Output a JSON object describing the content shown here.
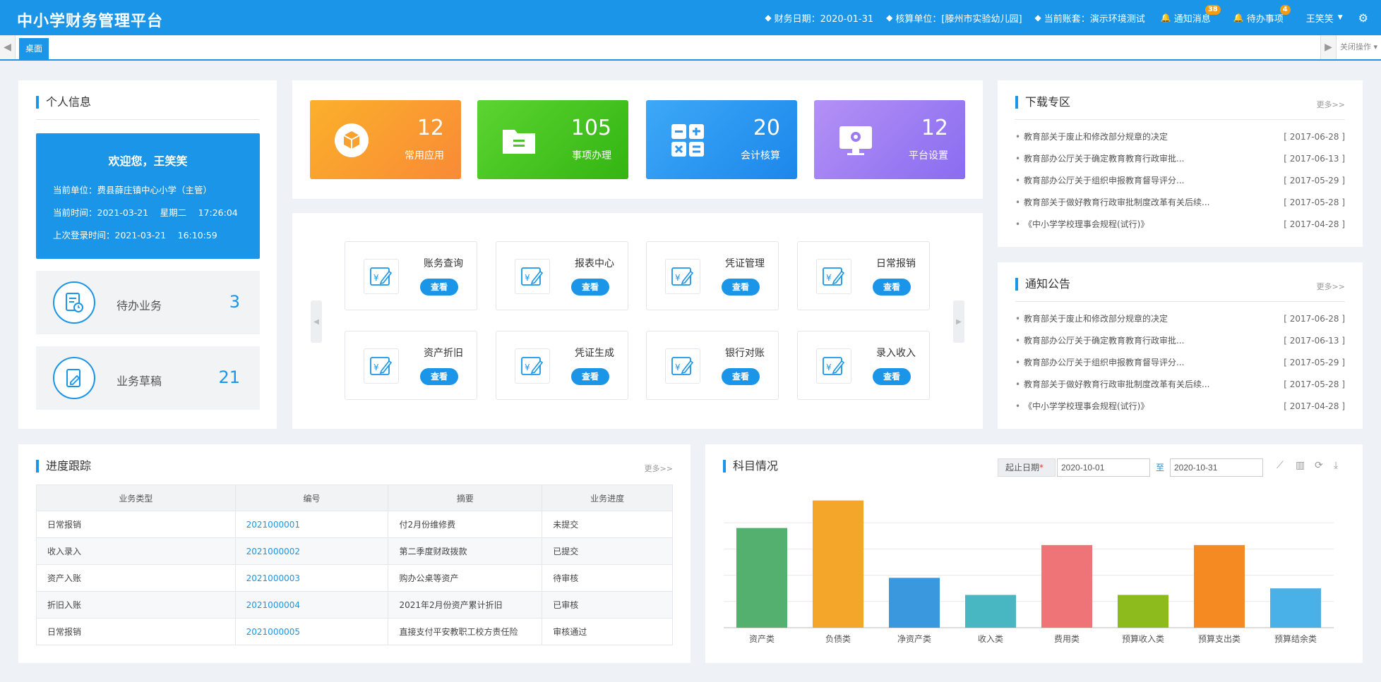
{
  "header": {
    "title": "中小学财务管理平台",
    "finance_date": "财务日期：2020-01-31",
    "unit": "核算单位：[滕州市实验幼儿园]",
    "account_set": "当前账套：演示环境测试",
    "notice": "通知消息",
    "notice_count": "38",
    "todo": "待办事项",
    "todo_count": "4",
    "user": "王笑笑"
  },
  "tabs": {
    "items": [
      "桌面"
    ],
    "close_label": "关闭操作"
  },
  "personal": {
    "title": "个人信息",
    "welcome": "欢迎您，王笑笑",
    "unit": "当前单位：费县薛庄镇中心小学（主管）",
    "time": "当前时间：2021-03-21　 星期二　 17:26:04",
    "last_login": "上次登录时间：2021-03-21　 16:10:59",
    "stats": [
      {
        "label": "待办业务",
        "value": "3"
      },
      {
        "label": "业务草稿",
        "value": "21"
      }
    ]
  },
  "tiles": [
    {
      "value": "12",
      "label": "常用应用",
      "icon": "cube-icon"
    },
    {
      "value": "105",
      "label": "事项办理",
      "icon": "folder-icon"
    },
    {
      "value": "20",
      "label": "会计核算",
      "icon": "calculator-icon"
    },
    {
      "value": "12",
      "label": "平台设置",
      "icon": "monitor-settings-icon"
    }
  ],
  "shortcuts": {
    "button_label": "查看",
    "items": [
      "账务查询",
      "报表中心",
      "凭证管理",
      "日常报销",
      "资产折旧",
      "凭证生成",
      "银行对账",
      "录入收入"
    ]
  },
  "downloads": {
    "title": "下载专区",
    "more": "更多>>",
    "items": [
      {
        "text": "教育部关于废止和修改部分规章的决定",
        "date": "[ 2017-06-28 ]"
      },
      {
        "text": "教育部办公厅关于确定教育教育行政审批...",
        "date": "[ 2017-06-13 ]"
      },
      {
        "text": "教育部办公厅关于组织申报教育督导评分...",
        "date": "[ 2017-05-29 ]"
      },
      {
        "text": "教育部关于做好教育行政审批制度改革有关后续...",
        "date": "[ 2017-05-28 ]"
      },
      {
        "text": "《中小学学校理事会规程(试行)》",
        "date": "[ 2017-04-28 ]"
      }
    ]
  },
  "notices": {
    "title": "通知公告",
    "more": "更多>>",
    "items": [
      {
        "text": "教育部关于废止和修改部分规章的决定",
        "date": "[ 2017-06-28 ]"
      },
      {
        "text": "教育部办公厅关于确定教育教育行政审批...",
        "date": "[ 2017-06-13 ]"
      },
      {
        "text": "教育部办公厅关于组织申报教育督导评分...",
        "date": "[ 2017-05-29 ]"
      },
      {
        "text": "教育部关于做好教育行政审批制度改革有关后续...",
        "date": "[ 2017-05-28 ]"
      },
      {
        "text": "《中小学学校理事会规程(试行)》",
        "date": "[ 2017-04-28 ]"
      }
    ]
  },
  "progress": {
    "title": "进度跟踪",
    "more": "更多>>",
    "columns": [
      "业务类型",
      "编号",
      "摘要",
      "业务进度"
    ],
    "rows": [
      [
        "日常报销",
        "2021000001",
        "付2月份维修费",
        "未提交"
      ],
      [
        "收入录入",
        "2021000002",
        "第二季度财政拨款",
        "已提交"
      ],
      [
        "资产入账",
        "2021000003",
        "购办公桌等资产",
        "待审核"
      ],
      [
        "折旧入账",
        "2021000004",
        "2021年2月份资产累计折旧",
        "已审核"
      ],
      [
        "日常报销",
        "2021000005",
        "直接支付平安教职工校方责任险",
        "审核通过"
      ]
    ]
  },
  "subjects": {
    "title": "科目情况",
    "date_label": "起止日期",
    "start_date": "2020-10-01",
    "to": "至",
    "end_date": "2020-10-31"
  },
  "chart_data": {
    "type": "bar",
    "categories": [
      "资产类",
      "负债类",
      "净资产类",
      "收入类",
      "费用类",
      "预算收入类",
      "预算支出类",
      "预算结余类"
    ],
    "values": [
      3.8,
      4.85,
      1.9,
      1.25,
      3.15,
      1.25,
      3.15,
      1.5
    ],
    "colors": [
      "#54b06e",
      "#f4a62a",
      "#3a98de",
      "#48b7c2",
      "#ef7478",
      "#8dbb1e",
      "#f58a22",
      "#4ab0e8"
    ],
    "ylim": [
      0,
      5
    ],
    "grid": true
  }
}
